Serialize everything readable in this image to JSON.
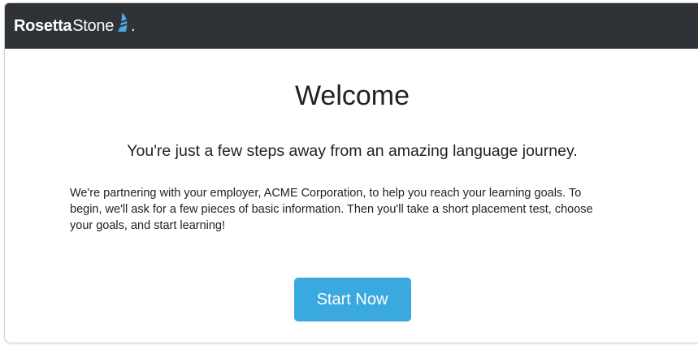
{
  "header": {
    "brand_bold": "Rosetta",
    "brand_light": "Stone",
    "brand_dot": ".",
    "logo_icon": "rosetta-stone-sail-icon",
    "background_color": "#2f3236"
  },
  "main": {
    "title": "Welcome",
    "subtitle": "You're just a few steps away from an amazing language journey.",
    "body": "We're partnering with your employer, ACME Corporation, to help you reach your learning goals. To begin, we'll ask for a few pieces of basic information. Then you'll take a short placement test, choose your goals, and start learning!",
    "start_button_label": "Start Now",
    "button_color": "#3aa9e0"
  }
}
